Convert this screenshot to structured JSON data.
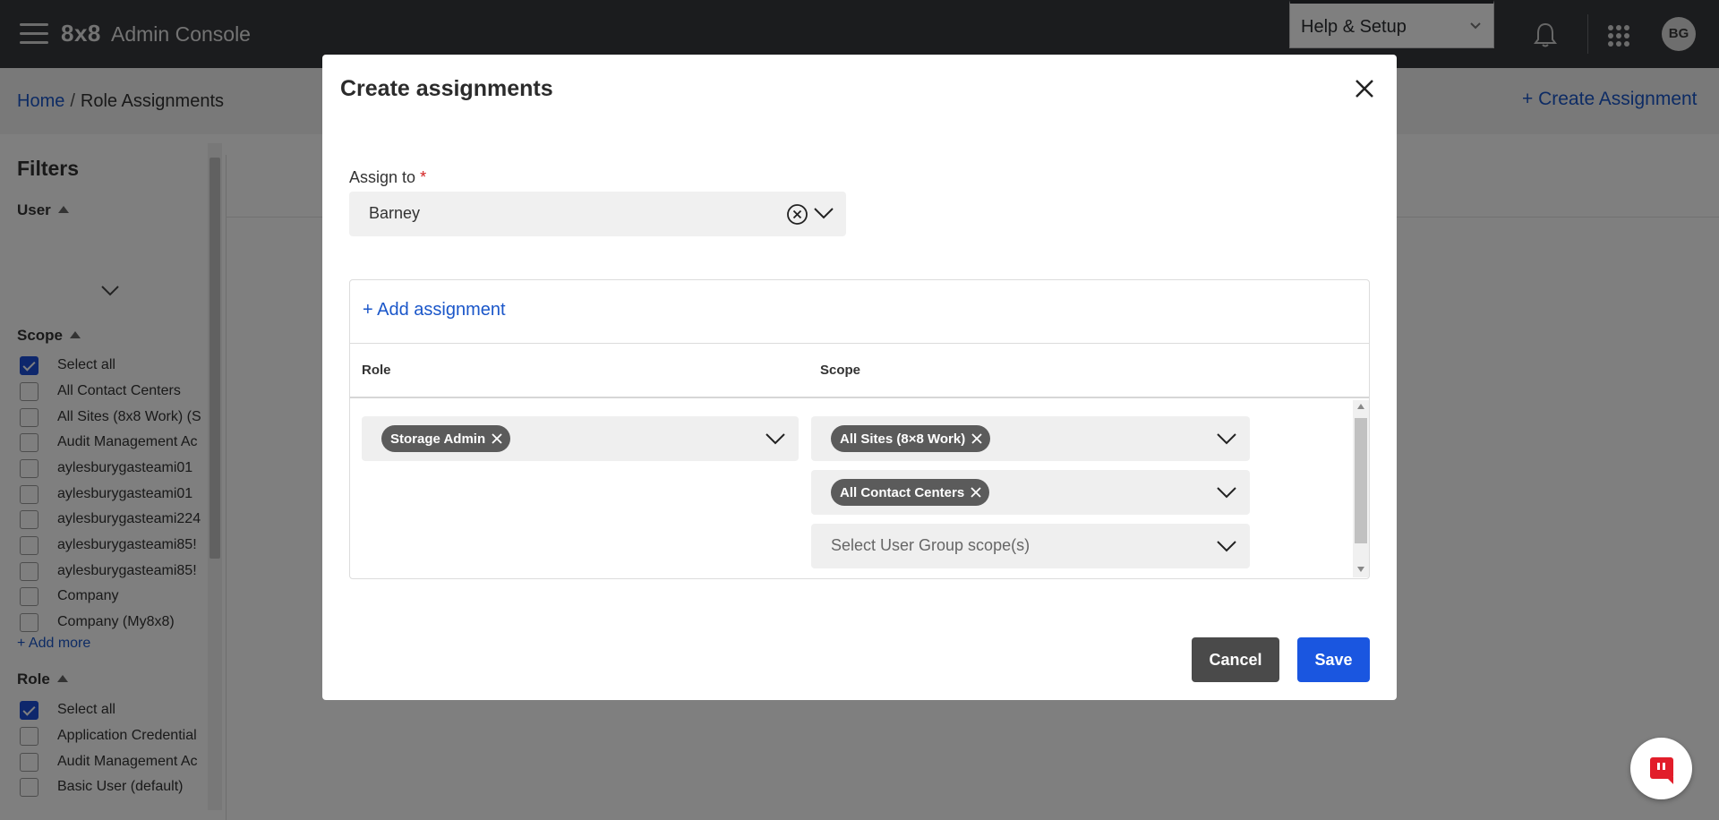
{
  "header": {
    "logo": "8x8",
    "app_title": "Admin Console",
    "help_menu": "Help & Setup",
    "avatar_initials": "BG"
  },
  "breadcrumb": {
    "home": "Home",
    "separator": "/",
    "current": "Role Assignments"
  },
  "page_actions": {
    "create_assignment": "+ Create Assignment"
  },
  "filters": {
    "title": "Filters",
    "user_section": "User",
    "scope_section": "Scope",
    "scope_items": [
      {
        "label": "Select all",
        "checked": true
      },
      {
        "label": "All Contact Centers",
        "checked": false
      },
      {
        "label": "All Sites (8x8 Work) (S",
        "checked": false
      },
      {
        "label": "Audit Management Ac",
        "checked": false
      },
      {
        "label": "aylesburygasteami01",
        "checked": false
      },
      {
        "label": "aylesburygasteami01",
        "checked": false
      },
      {
        "label": "aylesburygasteami224",
        "checked": false
      },
      {
        "label": "aylesburygasteami85!",
        "checked": false
      },
      {
        "label": "aylesburygasteami85!",
        "checked": false
      },
      {
        "label": "Company",
        "checked": false
      },
      {
        "label": "Company (My8x8)",
        "checked": false
      }
    ],
    "add_more": "+ Add more",
    "role_section": "Role",
    "role_items": [
      {
        "label": "Select all",
        "checked": true
      },
      {
        "label": "Application Credential",
        "checked": false
      },
      {
        "label": "Audit Management Ac",
        "checked": false
      },
      {
        "label": "Basic User (default)",
        "checked": false
      }
    ]
  },
  "modal": {
    "title": "Create assignments",
    "assign_to_label": "Assign to",
    "required_marker": "*",
    "assign_to_value": "Barney",
    "add_assignment": "+ Add assignment",
    "columns": {
      "role": "Role",
      "scope": "Scope"
    },
    "role_chip": "Storage Admin",
    "scope_chip_1": "All Sites (8×8 Work)",
    "scope_chip_2": "All Contact Centers",
    "scope_placeholder": "Select User Group scope(s)",
    "cancel": "Cancel",
    "save": "Save"
  }
}
